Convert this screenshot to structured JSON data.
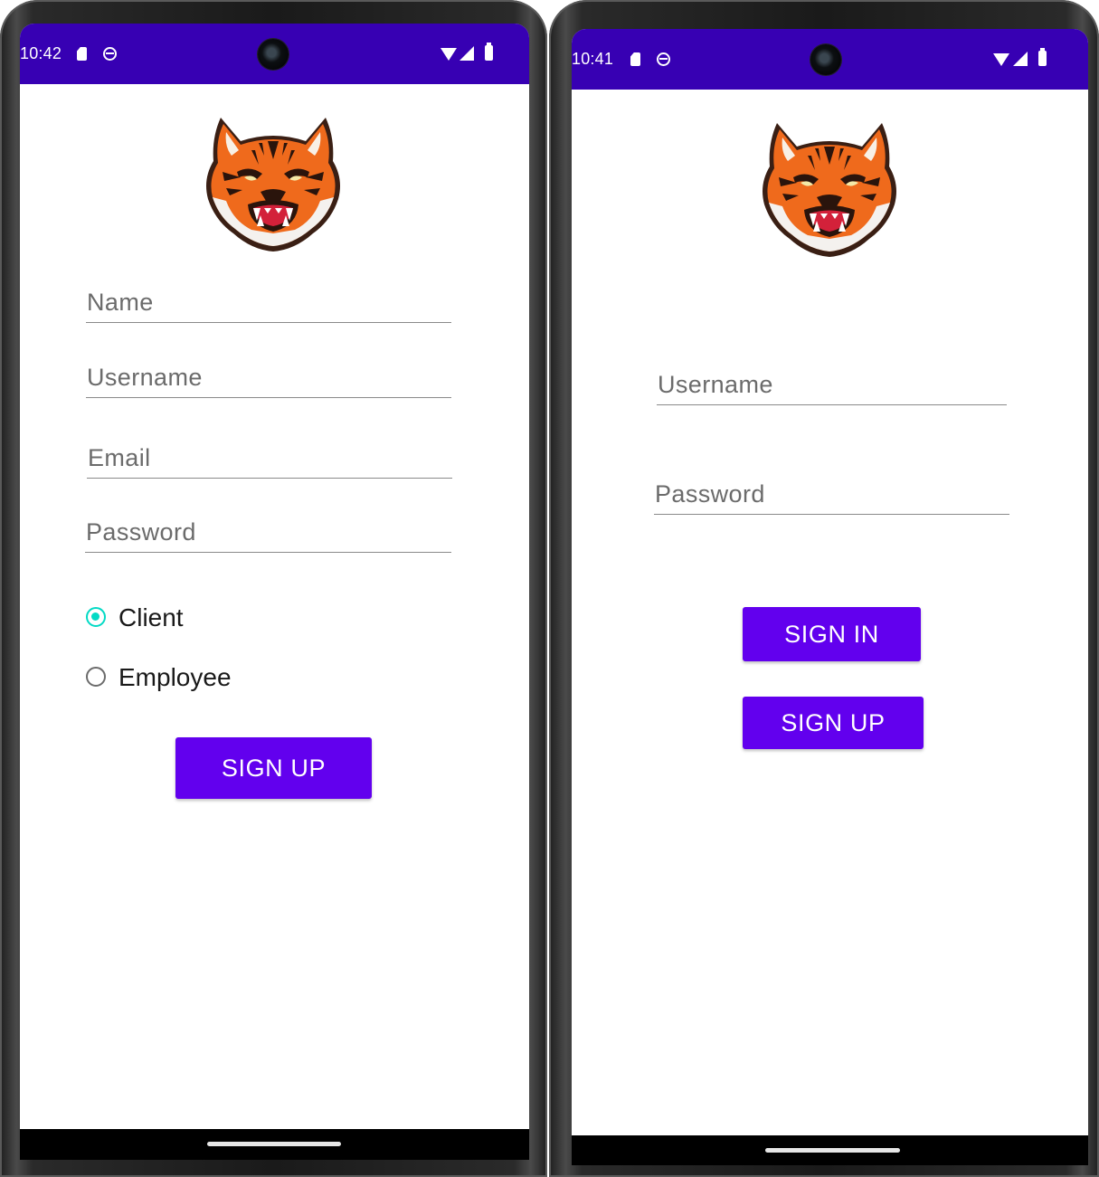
{
  "colors": {
    "status_bar": "#3700b3",
    "primary_button": "#6200ee",
    "radio_accent": "#03dac5",
    "navigation_bar": "#000000"
  },
  "left_screen": {
    "status": {
      "time": "10:42",
      "icons": [
        "sd-card-icon",
        "sync-icon",
        "camera-cutout",
        "wifi-icon",
        "signal-icon",
        "battery-icon"
      ]
    },
    "logo": "tiger-head-logo",
    "fields": {
      "name_placeholder": "Name",
      "username_placeholder": "Username",
      "email_placeholder": "Email",
      "password_placeholder": "Password"
    },
    "role_options": [
      {
        "label": "Client",
        "checked": true
      },
      {
        "label": "Employee",
        "checked": false
      }
    ],
    "signup_label": "SIGN UP"
  },
  "right_screen": {
    "status": {
      "time": "10:41",
      "icons": [
        "sd-card-icon",
        "sync-icon",
        "camera-cutout",
        "wifi-icon",
        "signal-icon",
        "battery-icon"
      ]
    },
    "logo": "tiger-head-logo",
    "fields": {
      "username_placeholder": "Username",
      "password_placeholder": "Password"
    },
    "signin_label": "SIGN IN",
    "signup_label": "SIGN UP"
  }
}
